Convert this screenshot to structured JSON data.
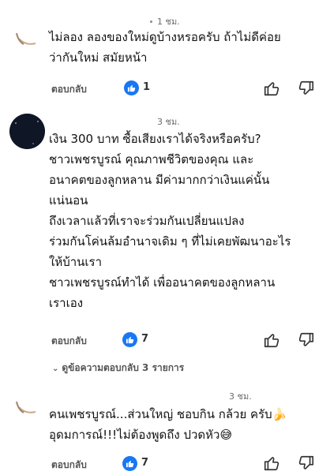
{
  "comments": [
    {
      "time": "1 ชม.",
      "lines": [
        "ไม่ลอง ลองของใหม่ดูบ้างหรอครับ ถ้าไม่ดีค่อย",
        "ว่ากันใหม่ สมัยหน้า"
      ],
      "reply_label": "ตอบกลับ",
      "like_count": "1"
    },
    {
      "time": "3 ชม.",
      "lines": [
        "เงิน 300 บาท ซื้อเสียงเราได้จริงหรือครับ?",
        "ชาวเพชรบูรณ์ คุณภาพชีวิตของคุณ และ",
        "อนาคตของลูกหลาน มีค่ามากกว่าเงินแค่นั้น",
        "แน่นอน",
        "ถึงเวลาแล้วที่เราจะร่วมกันเปลี่ยนแปลง",
        "ร่วมกันโค่นล้มอำนาจเดิม ๆ ที่ไม่เคยพัฒนาอะไร",
        "ให้บ้านเรา",
        "ชาวเพชรบูรณ์ทำได้ เพื่ออนาคตของลูกหลาน",
        "เราเอง"
      ],
      "reply_label": "ตอบกลับ",
      "like_count": "7",
      "view_replies": "ดูข้อความตอบกลับ 3 รายการ"
    },
    {
      "time": "3 ชม.",
      "lines": [
        "คนเพชรบูรณ์...ส่วนใหญ่ ชอบกิน กล้วย ครับ🍌",
        "อุดมการณ์!!!ไม่ต้องพูดถึง ปวดหัว😅"
      ],
      "reply_label": "ตอบกลับ",
      "like_count": "7"
    }
  ],
  "icons": {
    "like": "thumbs-up-icon",
    "dislike": "thumbs-down-icon",
    "avatar_moon": "crescent-moon-icon"
  },
  "colors": {
    "like_badge": "#1877f2",
    "moon": "#e9c24a"
  }
}
